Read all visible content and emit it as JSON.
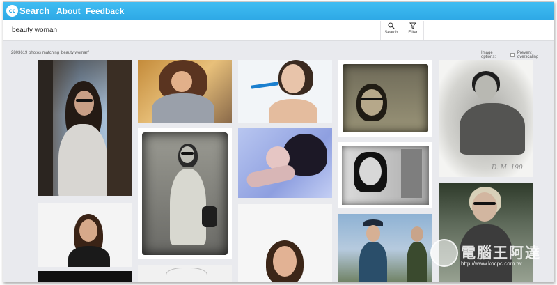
{
  "header": {
    "logo_badge": "cc",
    "logo_text": "Search",
    "nav": [
      {
        "label": "About"
      },
      {
        "label": "Feedback"
      }
    ]
  },
  "search": {
    "query": "beauty woman",
    "search_label": "Search",
    "filter_label": "Filter"
  },
  "results": {
    "count_text": "2803619 photos matching 'beauty woman'",
    "image_options_label": "Image options:",
    "prevent_overscaling_label": "Prevent overscaling",
    "prevent_overscaling_checked": false
  },
  "photos": [
    {
      "label": "photo-woman-sunglasses-skull-shirt"
    },
    {
      "label": "photo-woman-reading-curly-hair"
    },
    {
      "label": "photo-woman-makeup-brush"
    },
    {
      "label": "photo-woman-sunglasses-vignette"
    },
    {
      "label": "photo-vintage-woman-beach"
    },
    {
      "label": "photo-woman-smiling-white-background"
    },
    {
      "label": "photo-woman-sunglasses-bag-bw"
    },
    {
      "label": "photo-woman-lying-long-hair"
    },
    {
      "label": "photo-woman-bob-hair-bw"
    },
    {
      "label": "photo-woman-sunglasses-street"
    },
    {
      "label": "photo-women-hat-outdoor"
    },
    {
      "label": "photo-woman-smiling-portrait"
    }
  ],
  "watermark": {
    "text": "電腦王阿達",
    "url": "http://www.kocpc.com.tw"
  },
  "colors": {
    "header_bg": "#2ea9e6",
    "page_bg": "#e9eaee"
  }
}
